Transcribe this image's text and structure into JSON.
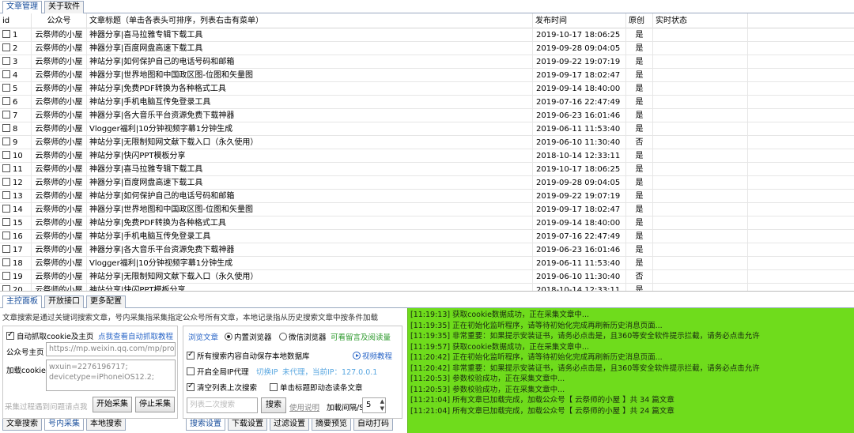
{
  "top_tabs": [
    "文章管理",
    "关于软件"
  ],
  "columns": [
    "id",
    "公众号",
    "文章标题（单击各表头可排序，列表右击有菜单）",
    "发布时间",
    "原创",
    "实时状态"
  ],
  "rows": [
    {
      "id": "1",
      "account": "云祭师的小屋",
      "title": "神器分享|喜马拉雅专辑下载工具",
      "time": "2019-10-17 18:06:25",
      "original": "是"
    },
    {
      "id": "2",
      "account": "云祭师的小屋",
      "title": "神器分享|百度网盘高速下载工具",
      "time": "2019-09-28 09:04:05",
      "original": "是"
    },
    {
      "id": "3",
      "account": "云祭师的小屋",
      "title": "神站分享|如何保护自己的电话号码和邮箱",
      "time": "2019-09-22 19:07:19",
      "original": "是"
    },
    {
      "id": "4",
      "account": "云祭师的小屋",
      "title": "神器分享|世界地图和中国政区图-位图和矢量图",
      "time": "2019-09-17 18:02:47",
      "original": "是"
    },
    {
      "id": "5",
      "account": "云祭师的小屋",
      "title": "神站分享|免费PDF转换为各种格式工具",
      "time": "2019-09-14 18:40:00",
      "original": "是"
    },
    {
      "id": "6",
      "account": "云祭师的小屋",
      "title": "神站分享|手机电脑互传免登录工具",
      "time": "2019-07-16 22:47:49",
      "original": "是"
    },
    {
      "id": "7",
      "account": "云祭师的小屋",
      "title": "神器分享|各大音乐平台资源免费下载神器",
      "time": "2019-06-23 16:01:46",
      "original": "是"
    },
    {
      "id": "8",
      "account": "云祭师的小屋",
      "title": "Vlogger福利|10分钟视频字幕1分钟生成",
      "time": "2019-06-11 11:53:40",
      "original": "是"
    },
    {
      "id": "9",
      "account": "云祭师的小屋",
      "title": "神站分享|无限制知网文献下载入口（永久使用）",
      "time": "2019-06-10 11:30:40",
      "original": "否"
    },
    {
      "id": "10",
      "account": "云祭师的小屋",
      "title": "神站分享|快闪PPT模板分享",
      "time": "2018-10-14 12:33:11",
      "original": "是"
    },
    {
      "id": "11",
      "account": "云祭师的小屋",
      "title": "神器分享|喜马拉雅专辑下载工具",
      "time": "2019-10-17 18:06:25",
      "original": "是"
    },
    {
      "id": "12",
      "account": "云祭师的小屋",
      "title": "神器分享|百度网盘高速下载工具",
      "time": "2019-09-28 09:04:05",
      "original": "是"
    },
    {
      "id": "13",
      "account": "云祭师的小屋",
      "title": "神站分享|如何保护自己的电话号码和邮箱",
      "time": "2019-09-22 19:07:19",
      "original": "是"
    },
    {
      "id": "14",
      "account": "云祭师的小屋",
      "title": "神器分享|世界地图和中国政区图-位图和矢量图",
      "time": "2019-09-17 18:02:47",
      "original": "是"
    },
    {
      "id": "15",
      "account": "云祭师的小屋",
      "title": "神站分享|免费PDF转换为各种格式工具",
      "time": "2019-09-14 18:40:00",
      "original": "是"
    },
    {
      "id": "16",
      "account": "云祭师的小屋",
      "title": "神站分享|手机电脑互传免登录工具",
      "time": "2019-07-16 22:47:49",
      "original": "是"
    },
    {
      "id": "17",
      "account": "云祭师的小屋",
      "title": "神器分享|各大音乐平台资源免费下载神器",
      "time": "2019-06-23 16:01:46",
      "original": "是"
    },
    {
      "id": "18",
      "account": "云祭师的小屋",
      "title": "Vlogger福利|10分钟视频字幕1分钟生成",
      "time": "2019-06-11 11:53:40",
      "original": "是"
    },
    {
      "id": "19",
      "account": "云祭师的小屋",
      "title": "神站分享|无限制知网文献下载入口（永久使用）",
      "time": "2019-06-10 11:30:40",
      "original": "否"
    },
    {
      "id": "20",
      "account": "云祭师的小屋",
      "title": "神站分享|快闪PPT模板分享",
      "time": "2018-10-14 12:33:11",
      "original": "是"
    }
  ],
  "mid_tabs": [
    "主控面板",
    "开放接口",
    "更多配置"
  ],
  "panel": {
    "hint": "文章搜索是通过关键词搜索文章，号内采集指采集指定公众号所有文章，本地记录指从历史搜索文章中按条件加载",
    "auto_cookie_label": "自动抓取cookie及主页",
    "auto_cookie_link": "点我查看自动抓取教程",
    "homepage_label": "公众号主页",
    "homepage_value": "https://mp.weixin.qq.com/mp/profi",
    "cookie_label": "加载cookie",
    "cookie_value": "wxuin=2276196717; devicetype=iPhoneiOS12.2;",
    "trouble_text": "采集过程遇到问题请点我",
    "start_button": "开始采集",
    "stop_button": "停止采集",
    "browse_label": "浏览文章",
    "radio_internal": "内置浏览器",
    "radio_wechat": "微信浏览器",
    "save_comments": "可看留言及阅读量",
    "auto_save": "所有搜索内容自动保存本地数据库",
    "video_tutorial": "视频教程",
    "global_ip": "开启全局IP代理",
    "switch_ip": "切换IP",
    "no_proxy": "未代理，当前IP：",
    "current_ip": "127.0.0.1",
    "clear_list": "清空列表上次搜索",
    "single_click": "单击标题即动态读条文章",
    "search_placeholder": "列表二次搜索",
    "search_button": "搜索",
    "usage_label": "使用说明",
    "interval_label": "加載间隔/S",
    "interval_value": "5"
  },
  "left_bottom_tabs": [
    "文章搜索",
    "号内采集",
    "本地搜索"
  ],
  "right_bottom_tabs": [
    "搜索设置",
    "下载设置",
    "过滤设置",
    "摘要预览",
    "自动打码"
  ],
  "log": [
    "[11:19:13] 获取cookie数据成功，正在采集文章中...",
    "[11:19:35] 正在初始化监听程序，请等待初始化完成再刷新历史消息页面...",
    "[11:19:35] 非常重要：如果提示安装证书，请务必点击是，且360等安全软件提示拦截，请务必点击允许",
    "[11:19:57] 获取cookie数据成功，正在采集文章中...",
    "[11:20:42] 正在初始化监听程序，请等待初始化完成再刷新历史消息页面...",
    "[11:20:42] 非常重要：如果提示安装证书，请务必点击是，且360等安全软件提示拦截，请务必点击允许",
    "[11:20:53] 参数校验成功，正在采集文章中...",
    "[11:20:53] 参数校验成功，正在采集文章中...",
    "[11:21:04] 所有文章已加载完成，加载公众号【 云祭师的小屋 】共 34 篇文章",
    "[11:21:04] 所有文章已加载完成，加载公众号【 云祭师的小屋 】共 24 篇文章"
  ],
  "colors": {
    "log_bg": "#6fdc1c",
    "link": "#2a66c7",
    "active_tab": "#1a4f9c"
  }
}
